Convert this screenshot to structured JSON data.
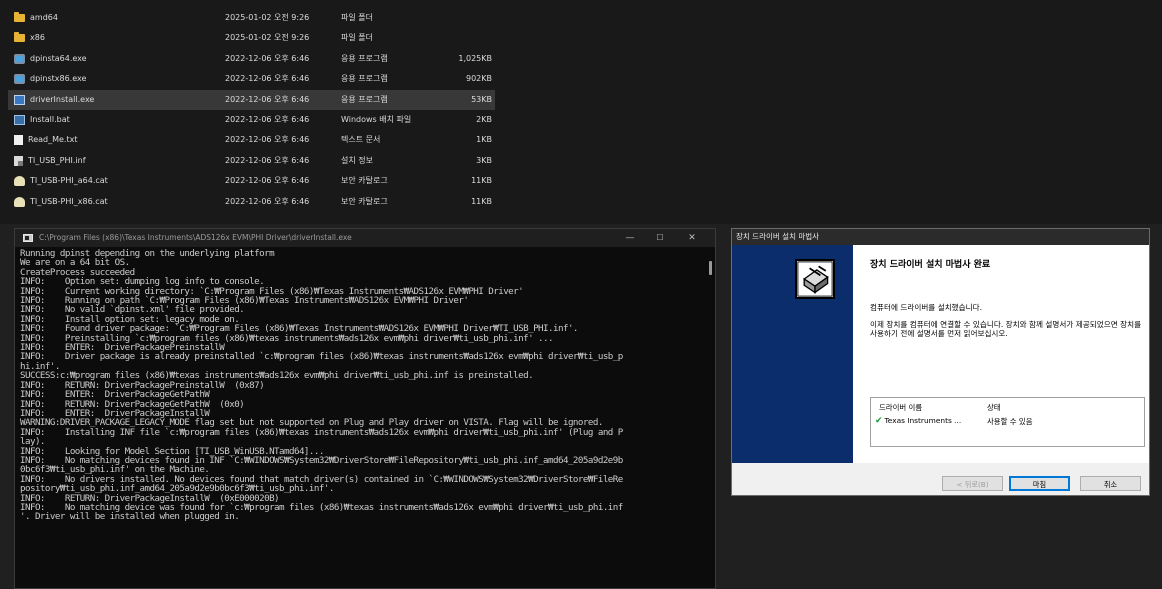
{
  "explorer": {
    "files": [
      {
        "icon": "folder-icon",
        "cls": "ic-folder",
        "name": "amd64",
        "date": "2025-01-02 오전 9:26",
        "type": "파일 폴더",
        "size": ""
      },
      {
        "icon": "folder-icon",
        "cls": "ic-folder",
        "name": "x86",
        "date": "2025-01-02 오전 9:26",
        "type": "파일 폴더",
        "size": ""
      },
      {
        "icon": "setup-exe-icon",
        "cls": "ic-exe",
        "name": "dpinsta64.exe",
        "date": "2022-12-06 오후 6:46",
        "type": "응용 프로그램",
        "size": "1,025KB"
      },
      {
        "icon": "setup-exe-icon",
        "cls": "ic-exe",
        "name": "dpinstx86.exe",
        "date": "2022-12-06 오후 6:46",
        "type": "응용 프로그램",
        "size": "902KB"
      },
      {
        "icon": "application-icon",
        "cls": "ic-app",
        "name": "driverInstall.exe",
        "date": "2022-12-06 오후 6:46",
        "type": "응용 프로그램",
        "size": "53KB",
        "selected": true
      },
      {
        "icon": "batch-file-icon",
        "cls": "ic-bat",
        "name": "Install.bat",
        "date": "2022-12-06 오후 6:46",
        "type": "Windows 배치 파일",
        "size": "2KB"
      },
      {
        "icon": "text-file-icon",
        "cls": "ic-txt",
        "name": "Read_Me.txt",
        "date": "2022-12-06 오후 6:46",
        "type": "텍스트 문서",
        "size": "1KB"
      },
      {
        "icon": "setup-info-icon",
        "cls": "ic-inf",
        "name": "TI_USB_PHI.inf",
        "date": "2022-12-06 오후 6:46",
        "type": "설치 정보",
        "size": "3KB"
      },
      {
        "icon": "security-catalog-icon",
        "cls": "ic-cat",
        "name": "TI_USB-PHI_a64.cat",
        "date": "2022-12-06 오후 6:46",
        "type": "보안 카탈로그",
        "size": "11KB"
      },
      {
        "icon": "security-catalog-icon",
        "cls": "ic-cat",
        "name": "TI_USB-PHI_x86.cat",
        "date": "2022-12-06 오후 6:46",
        "type": "보안 카탈로그",
        "size": "11KB"
      }
    ]
  },
  "console": {
    "title": "C:\\Program Files (x86)\\Texas Instruments\\ADS126x EVM\\PHI Driver\\driverInstall.exe",
    "minimize": "—",
    "maximize": "☐",
    "close": "✕",
    "lines": [
      "Running dpinst depending on the underlying platform",
      "We are on a 64 bit OS.",
      "CreateProcess succeeded",
      "INFO:    Option set: dumping log info to console.",
      "INFO:    Current working directory: `C:₩Program Files (x86)₩Texas Instruments₩ADS126x EVM₩PHI Driver'",
      "INFO:    Running on path `C:₩Program Files (x86)₩Texas Instruments₩ADS126x EVM₩PHI Driver'",
      "INFO:    No valid `dpinst.xml' file provided.",
      "INFO:    Install option set: legacy mode on.",
      "INFO:    Found driver package: `C:₩Program Files (x86)₩Texas Instruments₩ADS126x EVM₩PHI Driver₩TI_USB_PHI.inf'.",
      "INFO:    Preinstalling `c:₩program files (x86)₩texas instruments₩ads126x evm₩phi driver₩ti_usb_phi.inf' ...",
      "INFO:    ENTER:  DriverPackagePreinstallW",
      "INFO:    Driver package is already preinstalled `c:₩program files (x86)₩texas instruments₩ads126x evm₩phi driver₩ti_usb_p",
      "hi.inf'.",
      "SUCCESS:c:₩program files (x86)₩texas instruments₩ads126x evm₩phi driver₩ti_usb_phi.inf is preinstalled.",
      "INFO:    RETURN: DriverPackagePreinstallW  (0x87)",
      "INFO:    ENTER:  DriverPackageGetPathW",
      "INFO:    RETURN: DriverPackageGetPathW  (0x0)",
      "INFO:    ENTER:  DriverPackageInstallW",
      "WARNING:DRIVER_PACKAGE_LEGACY_MODE flag set but not supported on Plug and Play driver on VISTA. Flag will be ignored.",
      "INFO:    Installing INF file `c:₩program files (x86)₩texas instruments₩ads126x evm₩phi driver₩ti_usb_phi.inf' (Plug and P",
      "lay).",
      "INFO:    Looking for Model Section [TI_USB_WinUSB.NTamd64]...",
      "INFO:    No matching devices found in INF `C:₩WINDOWS₩System32₩DriverStore₩FileRepository₩ti_usb_phi.inf_amd64_205a9d2e9b",
      "0bc6f3₩ti_usb_phi.inf' on the Machine.",
      "INFO:    No drivers installed. No devices found that match driver(s) contained in `C:₩WINDOWS₩System32₩DriverStore₩FileRe",
      "pository₩ti_usb_phi.inf_amd64_205a9d2e9b0bc6f3₩ti_usb_phi.inf'.",
      "INFO:    RETURN: DriverPackageInstallW  (0xE000020B)",
      "INFO:    No matching device was found for `c:₩program files (x86)₩texas instruments₩ads126x evm₩phi driver₩ti_usb_phi.inf",
      "'. Driver will be installed when plugged in."
    ]
  },
  "wizard": {
    "window_title": "장치 드라이버 설치 마법사",
    "heading": "장치 드라이버 설치 마법사 완료",
    "line1": "컴퓨터에 드라이버를 설치했습니다.",
    "line2": "이제 장치를 컴퓨터에 연결할 수 있습니다. 장치와 함께 설명서가 제공되었으면 장치를 사용하기 전에 설명서를 먼저 읽어보십시오.",
    "table": {
      "col_name": "드라이버 이름",
      "col_status": "상태",
      "row_name": "Texas Instruments ...",
      "row_status": "사용할 수 있음"
    },
    "back_button": "< 뒤로(B)",
    "finish_button": "마침",
    "cancel_button": "취소"
  }
}
